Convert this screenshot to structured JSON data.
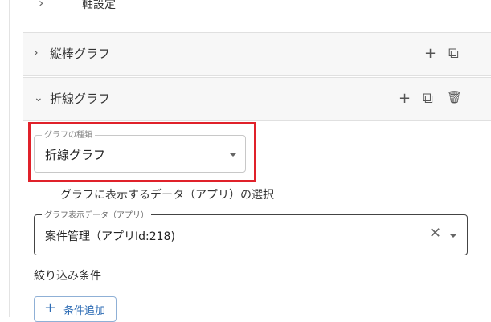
{
  "top_row": {
    "label": "軸設定",
    "chevron": "chevron-right-icon"
  },
  "accordion_bar": {
    "title": "縦棒グラフ",
    "add_symbol": "+",
    "copy_symbol": "⧉",
    "chevron": "chevron-right-icon"
  },
  "accordion_line": {
    "title": "折線グラフ",
    "add_symbol": "+",
    "copy_symbol": "⧉",
    "delete_symbol": "🗑",
    "chevron": "chevron-down-icon"
  },
  "graph_type": {
    "label": "グラフの種類",
    "value": "折線グラフ"
  },
  "section": {
    "title": "グラフに表示するデータ（アプリ）の選択"
  },
  "graph_data": {
    "label": "グラフ表示データ（アプリ）",
    "value": "案件管理（アプリId:218)",
    "clear_symbol": "✕"
  },
  "filter": {
    "label": "絞り込み条件",
    "add_button": "条件追加",
    "add_symbol": "+"
  },
  "colors": {
    "highlight": "#e0212a",
    "accent": "#2f6db5"
  }
}
